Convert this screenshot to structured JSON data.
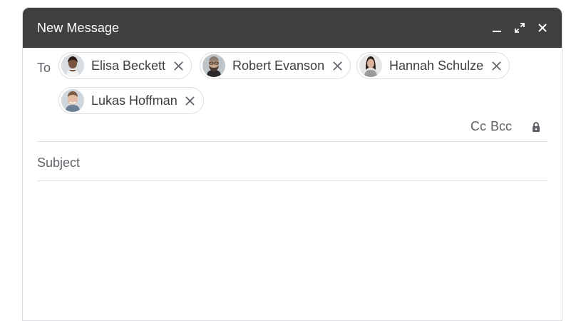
{
  "window": {
    "title": "New Message",
    "header_bg": "#404040",
    "actions": [
      {
        "name": "minimize-icon"
      },
      {
        "name": "expand-icon"
      },
      {
        "name": "close-icon"
      }
    ]
  },
  "recipients": {
    "label": "To",
    "chips": [
      {
        "name": "Elisa Beckett",
        "avatar": "woman-short-hair-avatar"
      },
      {
        "name": "Robert Evanson",
        "avatar": "man-beard-glasses-avatar"
      },
      {
        "name": "Hannah Schulze",
        "avatar": "woman-long-hair-avatar"
      },
      {
        "name": "Lukas Hoffman",
        "avatar": "man-smiling-avatar"
      }
    ]
  },
  "cc_bcc": {
    "cc_label": "Cc",
    "bcc_label": "Bcc",
    "lock_icon": "lock-icon"
  },
  "subject": {
    "placeholder": "Subject",
    "value": ""
  },
  "body": {
    "value": ""
  }
}
